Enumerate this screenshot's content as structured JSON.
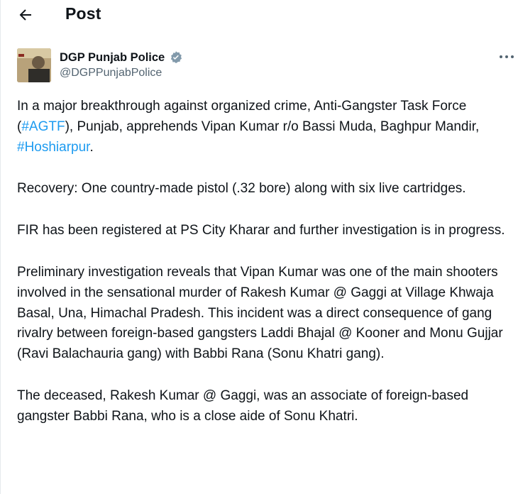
{
  "header": {
    "title": "Post"
  },
  "author": {
    "name": "DGP Punjab Police",
    "handle": "@DGPPunjabPolice"
  },
  "post": {
    "p1_a": "In a major breakthrough against organized crime, Anti-Gangster Task Force (",
    "p1_tag1": "#AGTF",
    "p1_b": "), Punjab, apprehends Vipan Kumar r/o Bassi Muda, Baghpur Mandir, ",
    "p1_tag2": "#Hoshiarpur",
    "p1_c": ".",
    "p2": "Recovery: One country-made pistol (.32 bore) along with six live cartridges.",
    "p3": "FIR has been registered at PS City Kharar and further investigation is in progress.",
    "p4": "Preliminary investigation reveals that Vipan Kumar was one of the main shooters involved in the sensational murder of Rakesh Kumar @ Gaggi at Village Khwaja Basal, Una, Himachal Pradesh. This incident was a direct consequence of gang rivalry between foreign-based gangsters Laddi Bhajal @ Kooner and Monu Gujjar (Ravi Balachauria gang) with Babbi Rana (Sonu Khatri gang).",
    "p5": "The deceased, Rakesh Kumar @ Gaggi, was an associate of foreign-based gangster Babbi Rana, who is a close aide of Sonu Khatri."
  },
  "icons": {
    "back": "back-arrow-icon",
    "verified": "verified-badge-icon",
    "more": "more-options-icon"
  },
  "colors": {
    "link": "#1d9bf0",
    "text": "#0f1419",
    "secondary": "#536471"
  }
}
